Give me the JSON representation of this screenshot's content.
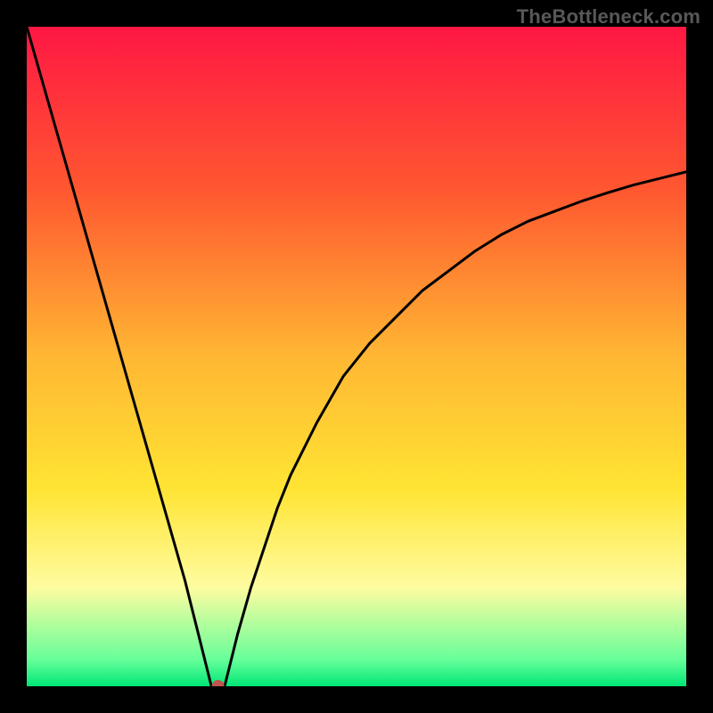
{
  "watermark": "TheBottleneck.com",
  "chart_data": {
    "type": "line",
    "title": "",
    "xlabel": "",
    "ylabel": "",
    "xlim": [
      0,
      100
    ],
    "ylim": [
      0,
      100
    ],
    "x": [
      0,
      2,
      4,
      6,
      8,
      10,
      12,
      14,
      16,
      18,
      20,
      22,
      24,
      25,
      26,
      27,
      28,
      29,
      30,
      32,
      34,
      36,
      38,
      40,
      44,
      48,
      52,
      56,
      60,
      64,
      68,
      72,
      76,
      80,
      84,
      88,
      92,
      96,
      100
    ],
    "values": [
      100,
      93,
      86,
      79,
      72,
      65,
      58,
      51,
      44,
      37,
      30,
      23,
      16,
      12,
      8,
      4,
      0,
      0,
      0,
      8,
      15,
      21,
      27,
      32,
      40,
      47,
      52,
      56,
      60,
      63,
      66,
      68.5,
      70.5,
      72,
      73.5,
      74.8,
      76,
      77,
      78
    ],
    "marker": {
      "x": 29,
      "y": 0,
      "color": "#c05550"
    },
    "background_gradient": {
      "stops": [
        {
          "offset": 0.0,
          "color": "#ff1744"
        },
        {
          "offset": 0.25,
          "color": "#ff5830"
        },
        {
          "offset": 0.5,
          "color": "#ffb733"
        },
        {
          "offset": 0.7,
          "color": "#ffe433"
        },
        {
          "offset": 0.85,
          "color": "#fffca0"
        },
        {
          "offset": 0.96,
          "color": "#66ff99"
        },
        {
          "offset": 1.0,
          "color": "#00e676"
        }
      ]
    },
    "curve_color": "#000000",
    "curve_width": 3
  }
}
